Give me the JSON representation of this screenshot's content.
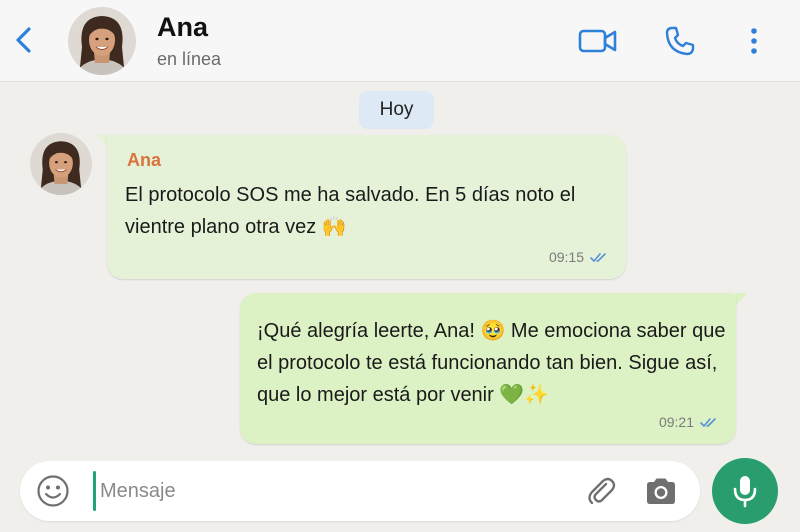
{
  "header": {
    "back_icon": "chevron-left-icon",
    "contact_name": "Ana",
    "contact_status": "en línea",
    "video_icon": "video-camera-icon",
    "call_icon": "phone-icon",
    "menu_icon": "more-vertical-icon",
    "accent_color": "#2f80d8"
  },
  "chat": {
    "date_label": "Hoy",
    "messages": [
      {
        "direction": "incoming",
        "sender": "Ana",
        "text": "El protocolo SOS me ha salvado. En 5 días noto el vientre plano otra vez 🙌",
        "time": "09:15",
        "status_icon": "double-check-icon"
      },
      {
        "direction": "outgoing",
        "text": "¡Qué alegría leerte, Ana! 🥹 Me emociona saber que el protocolo te está funcionando tan bien. Sigue así, que lo mejor está por venir 💚✨",
        "time": "09:21",
        "status_icon": "double-check-icon"
      }
    ],
    "incoming_bubble_color": "#e6f2d8",
    "outgoing_bubble_color": "#dcf2c5",
    "sender_color": "#d9743c"
  },
  "composer": {
    "placeholder": "Mensaje",
    "value": "",
    "emoji_icon": "emoji-smile-icon",
    "attach_icon": "paperclip-icon",
    "camera_icon": "camera-icon",
    "mic_icon": "microphone-icon",
    "mic_button_color": "#2a9d6e"
  }
}
